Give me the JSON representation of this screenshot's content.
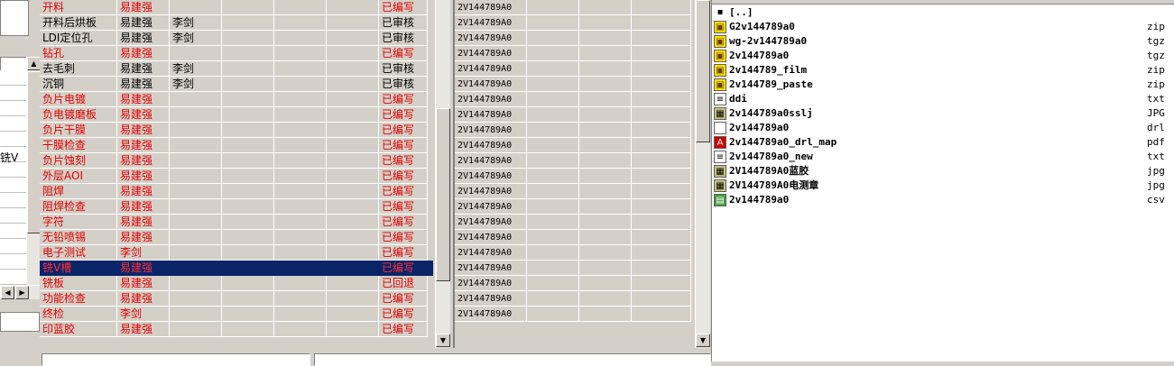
{
  "left_strip": {
    "clipped_label": "铣V"
  },
  "process_table": {
    "rows": [
      {
        "name": "开料",
        "editor": "易建强",
        "reviewer": "",
        "status": "已编写",
        "red": true,
        "selected": false
      },
      {
        "name": "开料后烘板",
        "editor": "易建强",
        "reviewer": "李剑",
        "status": "已审核",
        "red": false,
        "selected": false
      },
      {
        "name": "LDI定位孔",
        "editor": "易建强",
        "reviewer": "李剑",
        "status": "已审核",
        "red": false,
        "selected": false
      },
      {
        "name": "钻孔",
        "editor": "易建强",
        "reviewer": "",
        "status": "已编写",
        "red": true,
        "selected": false
      },
      {
        "name": "去毛刺",
        "editor": "易建强",
        "reviewer": "李剑",
        "status": "已审核",
        "red": false,
        "selected": false
      },
      {
        "name": "沉铜",
        "editor": "易建强",
        "reviewer": "李剑",
        "status": "已审核",
        "red": false,
        "selected": false
      },
      {
        "name": "负片电镀",
        "editor": "易建强",
        "reviewer": "",
        "status": "已编写",
        "red": true,
        "selected": false
      },
      {
        "name": "负电镀磨板",
        "editor": "易建强",
        "reviewer": "",
        "status": "已编写",
        "red": true,
        "selected": false
      },
      {
        "name": "负片干膜",
        "editor": "易建强",
        "reviewer": "",
        "status": "已编写",
        "red": true,
        "selected": false
      },
      {
        "name": "干膜检查",
        "editor": "易建强",
        "reviewer": "",
        "status": "已编写",
        "red": true,
        "selected": false
      },
      {
        "name": "负片蚀刻",
        "editor": "易建强",
        "reviewer": "",
        "status": "已编写",
        "red": true,
        "selected": false
      },
      {
        "name": "外层AOI",
        "editor": "易建强",
        "reviewer": "",
        "status": "已编写",
        "red": true,
        "selected": false
      },
      {
        "name": "阻焊",
        "editor": "易建强",
        "reviewer": "",
        "status": "已编写",
        "red": true,
        "selected": false
      },
      {
        "name": "阻焊检查",
        "editor": "易建强",
        "reviewer": "",
        "status": "已编写",
        "red": true,
        "selected": false
      },
      {
        "name": "字符",
        "editor": "易建强",
        "reviewer": "",
        "status": "已编写",
        "red": true,
        "selected": false
      },
      {
        "name": "无铅喷锡",
        "editor": "易建强",
        "reviewer": "",
        "status": "已编写",
        "red": true,
        "selected": false
      },
      {
        "name": "电子测试",
        "editor": "李剑",
        "reviewer": "",
        "status": "已编写",
        "red": true,
        "selected": false
      },
      {
        "name": "铣V槽",
        "editor": "易建强",
        "reviewer": "",
        "status": "已编写",
        "red": true,
        "selected": true
      },
      {
        "name": "铣板",
        "editor": "易建强",
        "reviewer": "",
        "status": "已回退",
        "red": true,
        "selected": false
      },
      {
        "name": "功能检查",
        "editor": "易建强",
        "reviewer": "",
        "status": "已编写",
        "red": true,
        "selected": false
      },
      {
        "name": "终检",
        "editor": "李剑",
        "reviewer": "",
        "status": "已编写",
        "red": true,
        "selected": false
      },
      {
        "name": "印蓝胶",
        "editor": "易建强",
        "reviewer": "",
        "status": "已编写",
        "red": true,
        "selected": false
      }
    ]
  },
  "code_table": {
    "rows": [
      "2V144789A0",
      "2V144789A0",
      "2V144789A0",
      "2V144789A0",
      "2V144789A0",
      "2V144789A0",
      "2V144789A0",
      "2V144789A0",
      "2V144789A0",
      "2V144789A0",
      "2V144789A0",
      "2V144789A0",
      "2V144789A0",
      "2V144789A0",
      "2V144789A0",
      "2V144789A0",
      "2V144789A0",
      "2V144789A0",
      "2V144789A0",
      "2V144789A0",
      "2V144789A0"
    ]
  },
  "scroll_glyphs": {
    "up": "▲",
    "down": "▼",
    "left": "◀",
    "right": "▶"
  },
  "file_list": {
    "items": [
      {
        "name": "[..]",
        "ext": "",
        "icon": "parent-dir-icon"
      },
      {
        "name": "G2v144789a0",
        "ext": "zip",
        "icon": "archive-icon"
      },
      {
        "name": "wg-2v144789a0",
        "ext": "tgz",
        "icon": "archive-icon"
      },
      {
        "name": "2v144789a0",
        "ext": "tgz",
        "icon": "archive-icon"
      },
      {
        "name": "2v144789_film",
        "ext": "zip",
        "icon": "archive-icon"
      },
      {
        "name": "2v144789_paste",
        "ext": "zip",
        "icon": "archive-icon"
      },
      {
        "name": "ddi",
        "ext": "txt",
        "icon": "text-file-icon"
      },
      {
        "name": "2v144789a0sslj",
        "ext": "JPG",
        "icon": "image-file-icon"
      },
      {
        "name": "2v144789a0",
        "ext": "drl",
        "icon": "blank-file-icon"
      },
      {
        "name": "2v144789a0_drl_map",
        "ext": "pdf",
        "icon": "pdf-file-icon"
      },
      {
        "name": "2v144789a0_new",
        "ext": "txt",
        "icon": "text-file-icon"
      },
      {
        "name": "2V144789A0蓝胶",
        "ext": "jpg",
        "icon": "image-file-icon"
      },
      {
        "name": "2V144789A0电测章",
        "ext": "jpg",
        "icon": "image-file-icon"
      },
      {
        "name": "2v144789a0",
        "ext": "csv",
        "icon": "spreadsheet-file-icon"
      }
    ]
  }
}
